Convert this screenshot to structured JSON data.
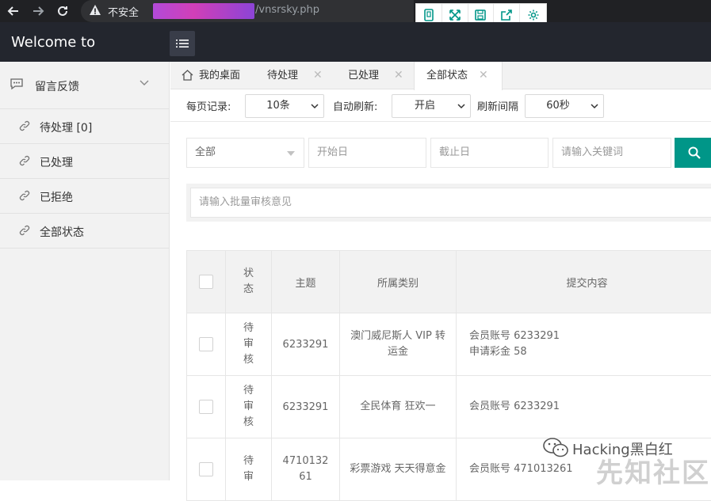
{
  "browser": {
    "insecure_label": "不安全",
    "url": "/vnsrsky.php"
  },
  "app": {
    "brand": "Welcome to"
  },
  "sidebar": {
    "group_label": "留言反馈",
    "items": [
      {
        "label": "待处理 [0]"
      },
      {
        "label": "已处理"
      },
      {
        "label": "已拒绝"
      },
      {
        "label": "全部状态"
      }
    ]
  },
  "tabs": [
    {
      "label": "我的桌面"
    },
    {
      "label": "待处理"
    },
    {
      "label": "已处理"
    },
    {
      "label": "全部状态"
    }
  ],
  "filters": {
    "per_page_label": "每页记录:",
    "per_page_value": "10条",
    "auto_refresh_label": "自动刷新:",
    "auto_refresh_value": "开启",
    "interval_label": "刷新间隔",
    "interval_value": "60秒"
  },
  "search": {
    "category_value": "全部",
    "start_placeholder": "开始日",
    "end_placeholder": "截止日",
    "keyword_placeholder": "请输入关键词"
  },
  "batch": {
    "placeholder": "请输入批量审核意见"
  },
  "table": {
    "headers": {
      "status": "状态",
      "subject": "主题",
      "category": "所属类别",
      "content": "提交内容"
    },
    "rows": [
      {
        "status": "待审核",
        "subject": "6233291",
        "category": "澳门威尼斯人 VIP 转运金",
        "content_line1": "会员账号 6233291",
        "content_line2": "申请彩金 58"
      },
      {
        "status": "待审核",
        "subject": "6233291",
        "category": "全民体育 狂欢一",
        "content_line1": "会员账号 6233291",
        "content_line2": ""
      },
      {
        "status": "待审",
        "subject": "471013261",
        "category": "彩票游戏 天天得意金",
        "content_line1": "会员账号 471013261",
        "content_line2": ""
      }
    ]
  },
  "watermark": {
    "text": "Hacking黑白红",
    "big_text": "先知社区"
  },
  "colors": {
    "accent": "#009688",
    "topbar": "#23262e",
    "redaction": "#c040d0"
  }
}
